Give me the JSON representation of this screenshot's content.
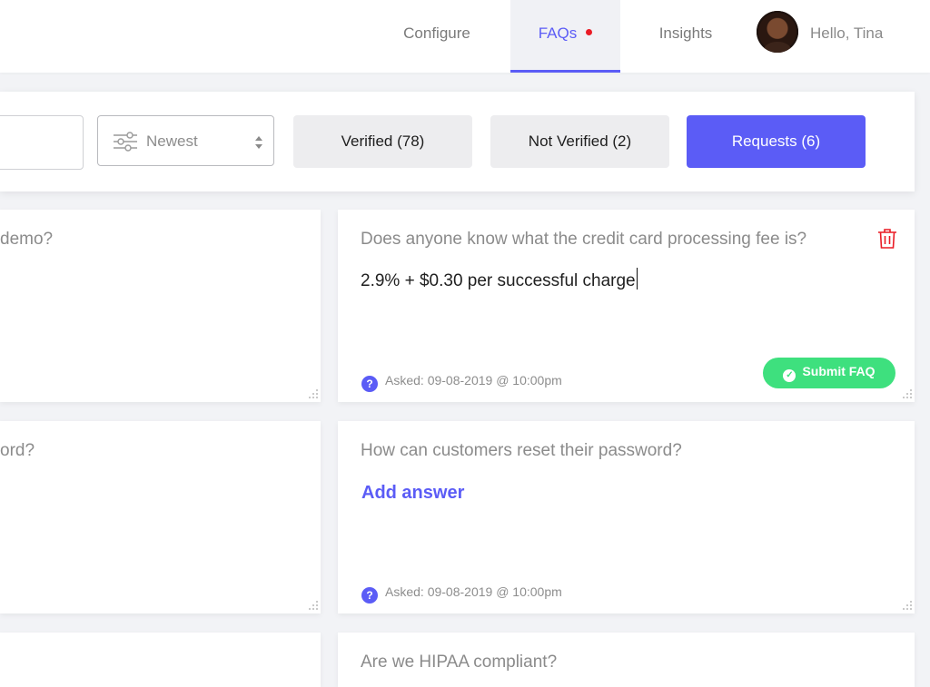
{
  "nav": {
    "tabs": [
      {
        "label": "Configure",
        "active": false
      },
      {
        "label": "FAQs",
        "active": true,
        "has_notification": true
      },
      {
        "label": "Insights",
        "active": false
      }
    ],
    "greeting": "Hello, Tina"
  },
  "filters": {
    "search_value": "",
    "sort_value": "Newest",
    "verified_label": "Verified (78)",
    "not_verified_label": "Not Verified (2)",
    "requests_label": "Requests  (6)"
  },
  "cards_left": [
    {
      "question": "demo?"
    },
    {
      "question": "ord?"
    },
    {
      "question": ""
    }
  ],
  "cards_right": [
    {
      "question": "Does anyone know what the credit card processing fee is?",
      "answer": "2.9% + $0.30 per successful charge",
      "asked": "Asked: 09-08-2019 @ 10:00pm",
      "submit_label": "Submit FAQ"
    },
    {
      "question": "How can customers reset their password?",
      "add_answer_label": "Add answer",
      "asked": "Asked: 09-08-2019 @ 10:00pm"
    },
    {
      "question": "Are we HIPAA compliant?"
    }
  ],
  "colors": {
    "accent": "#5b5cf6",
    "success": "#3ee07e",
    "danger": "#ea1b25",
    "background": "#f2f3f6"
  },
  "icons": {
    "filter": "sliders-icon",
    "sort": "up-down-arrows-icon",
    "help": "question-circle-icon",
    "delete": "trash-icon",
    "check": "check-circle-icon",
    "resize": "resize-handle-icon"
  }
}
